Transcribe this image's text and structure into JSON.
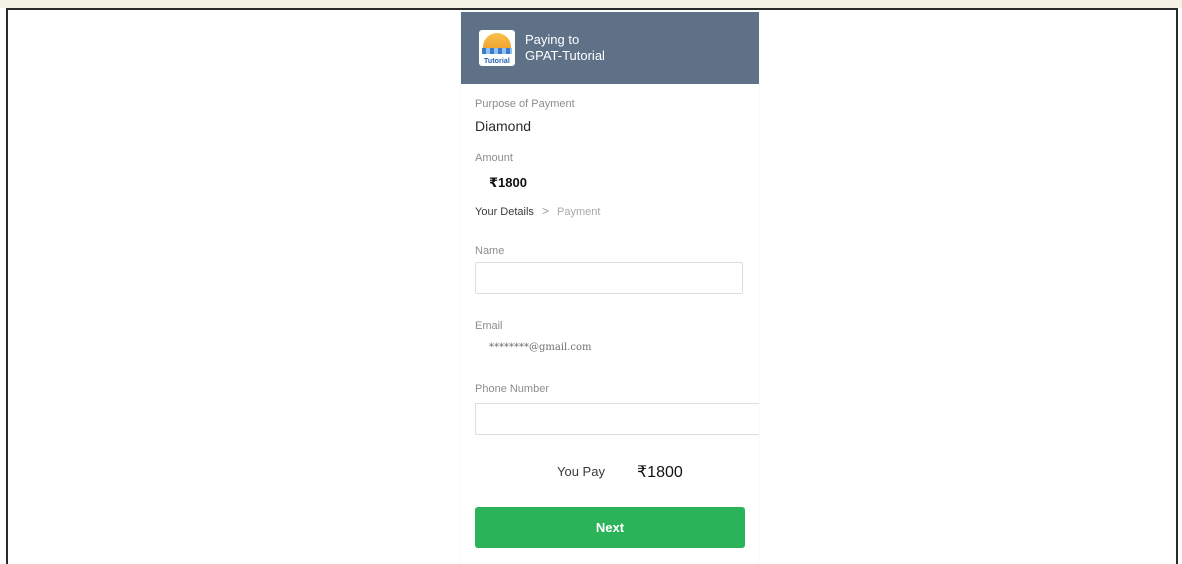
{
  "header": {
    "logo_text": "Tutorial",
    "paying_to": "Paying to",
    "merchant": "GPAT-Tutorial"
  },
  "purpose": {
    "label": "Purpose of Payment",
    "value": "Diamond"
  },
  "amount": {
    "label": "Amount",
    "value": "₹1800"
  },
  "steps": {
    "current": "Your Details",
    "next": "Payment"
  },
  "form": {
    "name_label": "Name",
    "name_value": "",
    "email_label": "Email",
    "email_value": "********@gmail.com",
    "phone_label": "Phone Number",
    "phone_value": ""
  },
  "summary": {
    "you_pay_label": "You Pay",
    "total": "₹1800"
  },
  "actions": {
    "next_label": "Next"
  },
  "colors": {
    "header_bg": "#5f7187",
    "button_bg": "#2bb359"
  }
}
